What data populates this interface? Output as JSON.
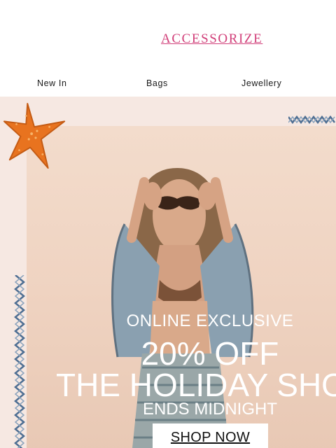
{
  "header": {
    "logo_text": "ACCESSORIZE"
  },
  "nav": {
    "items": [
      {
        "label": "New In"
      },
      {
        "label": "Bags"
      },
      {
        "label": "Jewellery"
      }
    ]
  },
  "hero": {
    "line1": "ONLINE EXCLUSIVE",
    "line2": "20% OFF",
    "line3": "THE HOLIDAY SHOP",
    "line4": "ENDS MIDNIGHT",
    "cta_label": "SHOP NOW"
  },
  "colors": {
    "brand_pink": "#d1407a",
    "hero_background": "#f6e8e2",
    "starfish_orange": "#e8731f",
    "zigzag_blue": "#4f6f93"
  },
  "icons": [
    "starfish-illustration",
    "zigzag-decoration"
  ]
}
